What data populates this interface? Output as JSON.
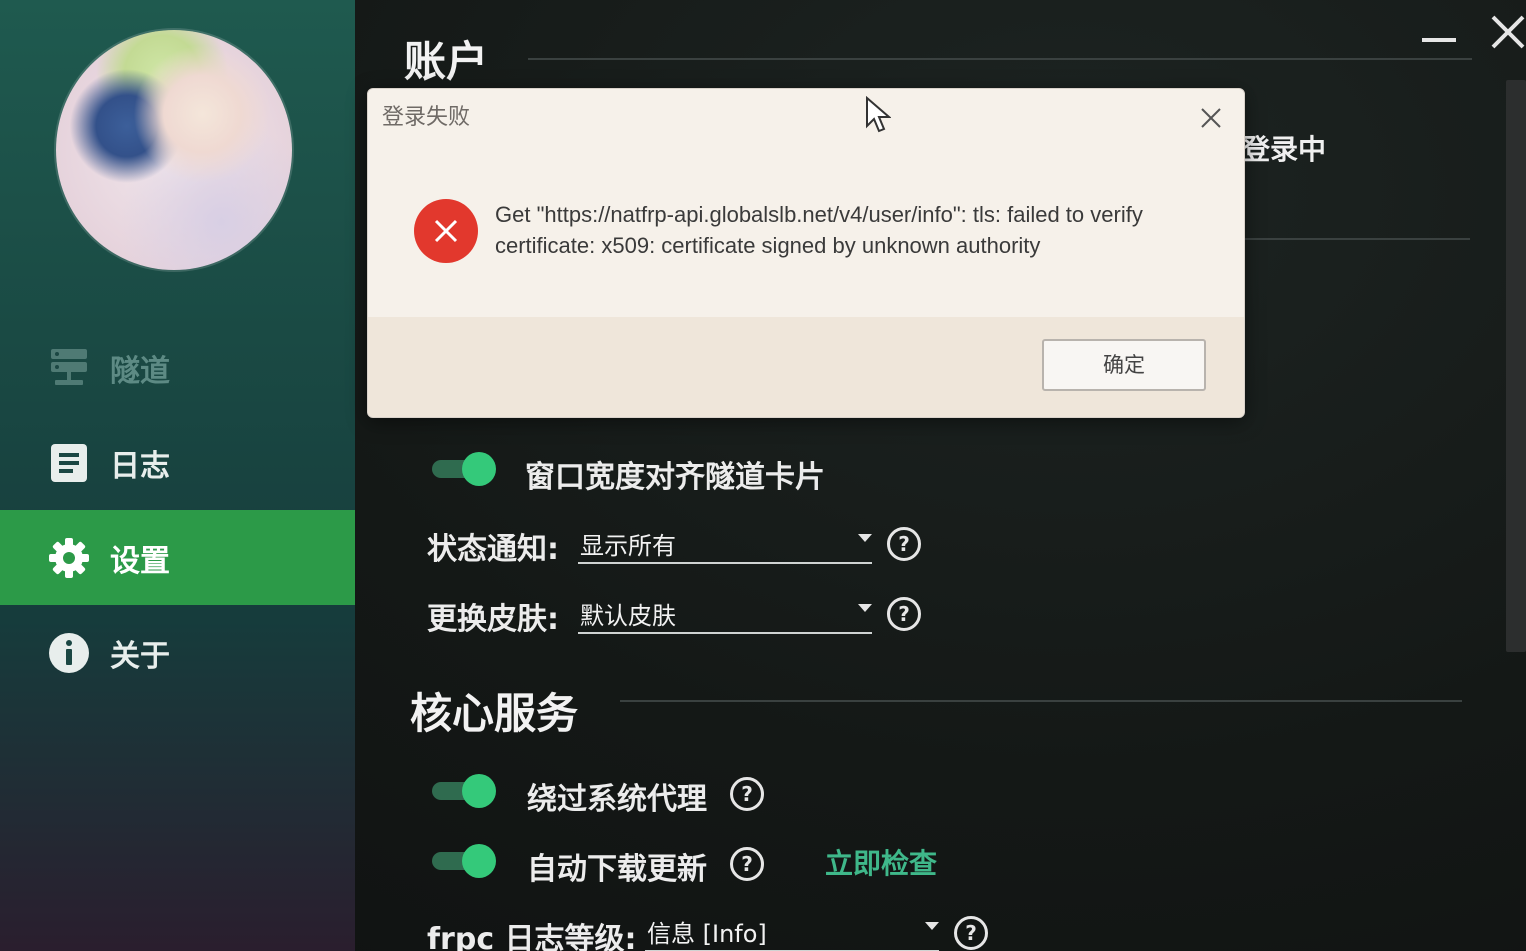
{
  "sidebar": {
    "items": [
      {
        "label": "隧道",
        "icon": "server-icon"
      },
      {
        "label": "日志",
        "icon": "document-icon"
      },
      {
        "label": "设置",
        "icon": "gear-icon"
      },
      {
        "label": "关于",
        "icon": "info-icon"
      }
    ],
    "active_color": "#2c9a48"
  },
  "sections": {
    "account_title": "账户",
    "account_status": "登录中",
    "core_title": "核心服务"
  },
  "settings": {
    "align_width_label": "窗口宽度对齐隧道卡片",
    "status_notify_label": "状态通知:",
    "status_notify_value": "显示所有",
    "skin_label": "更换皮肤:",
    "skin_value": "默认皮肤",
    "bypass_proxy_label": "绕过系统代理",
    "auto_update_label": "自动下载更新",
    "check_now_link": "立即检查",
    "frpc_log_label": "frpc 日志等级:",
    "frpc_log_value": "信息 [Info]",
    "help_glyph": "?"
  },
  "dialog": {
    "title": "登录失败",
    "message": "Get \"https://natfrp-api.globalslb.net/v4/user/info\": tls: failed to verify certificate: x509: certificate signed by unknown authority",
    "ok_label": "确定"
  },
  "colors": {
    "accent": "#34c97a",
    "error": "#e2382d",
    "link": "#3fb88a"
  }
}
